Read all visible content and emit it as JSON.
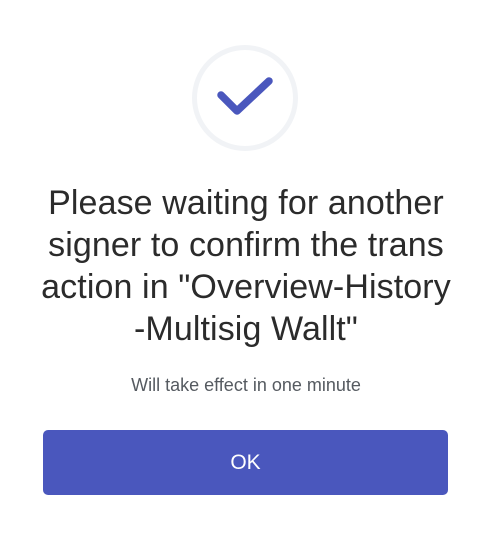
{
  "dialog": {
    "icon": "check-icon",
    "accent_color": "#4a57bd",
    "title": "Please waiting for another signer to confirm the transaction in \"Overview-History-Multisig Wallt\"",
    "subtitle": "Will take effect in one minute",
    "ok_label": "OK"
  }
}
